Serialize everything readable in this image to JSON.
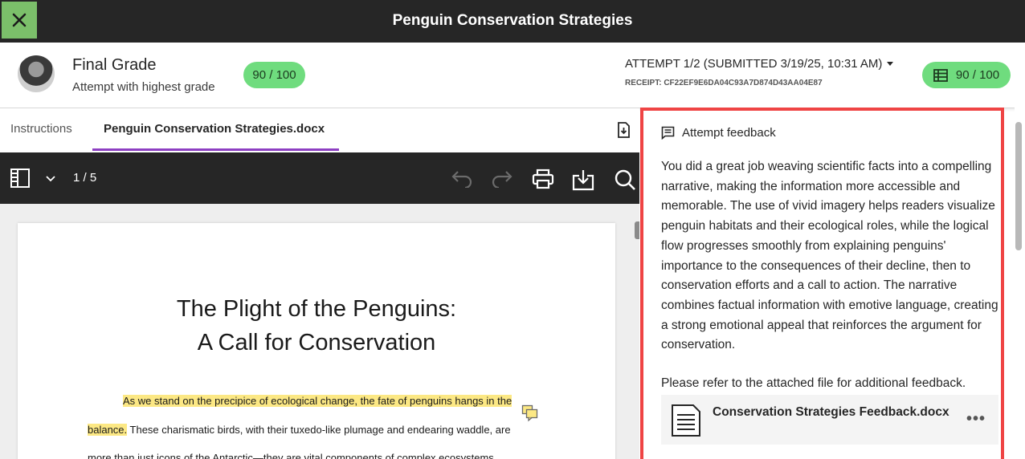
{
  "header": {
    "title": "Penguin Conservation Strategies"
  },
  "grade": {
    "label": "Final Grade",
    "sub": "Attempt with highest grade",
    "score": "90 / 100",
    "attempt": "ATTEMPT 1/2 (SUBMITTED 3/19/25, 10:31 AM)",
    "receipt": "RECEIPT: CF22EF9E6DA04C93A7D874D43AA04E87",
    "attempt_score": "90 / 100"
  },
  "tabs": [
    {
      "label": "Instructions"
    },
    {
      "label": "Penguin Conservation Strategies.docx"
    }
  ],
  "toolbar": {
    "page": "1 / 5"
  },
  "document": {
    "title_line1": "The Plight of the Penguins:",
    "title_line2": "A Call for Conservation",
    "para_line1": "As we stand on the precipice of ecological change, the fate of penguins hangs in the",
    "para_line2_hl": "balance.",
    "para_line2_rest": " These charismatic birds, with their tuxedo-like plumage and endearing waddle, are",
    "para_line3": "more than just icons of the Antarctic—they are vital components of complex ecosystems"
  },
  "feedback": {
    "heading": "Attempt feedback",
    "body": "You did a great job weaving scientific facts into a compelling narrative, making the information more accessible and memorable. The use of vivid imagery helps readers visualize penguin habitats and their ecological roles, while the logical flow progresses smoothly from explaining penguins' importance to the consequences of their decline, then to conservation efforts and a call to action. The narrative combines factual information with emotive language, creating a strong emotional appeal that reinforces the argument for conservation.",
    "note": "Please refer to the attached file for additional feedback.",
    "attachment": "Conservation Strategies Feedback.docx",
    "more": "•••"
  },
  "colors": {
    "accent_green": "#6fdc7e",
    "highlight_border": "#ef4444",
    "tab_underline": "#8d3fc2"
  }
}
